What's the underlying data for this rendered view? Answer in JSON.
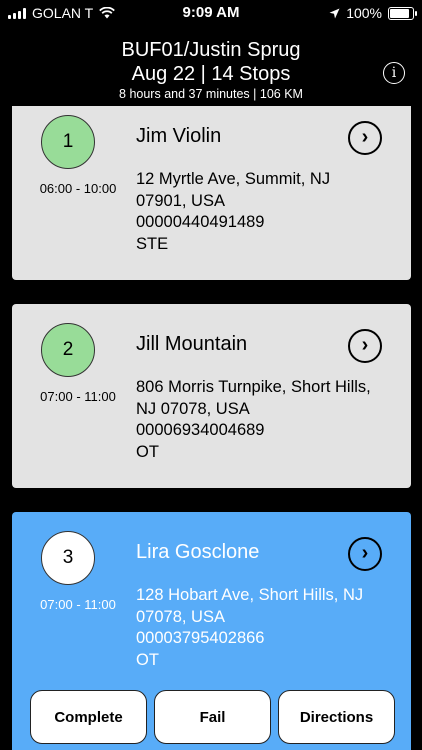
{
  "status_bar": {
    "carrier": "GOLAN T",
    "time": "9:09 AM",
    "battery": "100%",
    "battery_level": 1.0
  },
  "header": {
    "title": "BUF01/Justin Sprug",
    "subtitle": "Aug 22 | 14 Stops",
    "meta": "8 hours and 37 minutes | 106 KM",
    "info_icon": "i"
  },
  "stops": [
    {
      "number": "1",
      "time_window": "06:00 - 10:00",
      "name": "Jim Violin",
      "address_line1": "12 Myrtle Ave, Summit, NJ",
      "address_line2": "07901, USA",
      "order_id": "00000440491489",
      "code": "STE"
    },
    {
      "number": "2",
      "time_window": "07:00 - 11:00",
      "name": "Jill Mountain",
      "address_line1": "806 Morris Turnpike, Short Hills,",
      "address_line2": "NJ 07078, USA",
      "order_id": "00006934004689",
      "code": "OT"
    },
    {
      "number": "3",
      "time_window": "07:00 - 11:00",
      "name": "Lira Gosclone",
      "address_line1": "128 Hobart Ave, Short Hills, NJ",
      "address_line2": "07078, USA",
      "order_id": "00003795402866",
      "code": "OT"
    }
  ],
  "actions": {
    "complete": "Complete",
    "fail": "Fail",
    "directions": "Directions"
  },
  "icons": {
    "chevron": "›"
  },
  "colors": {
    "card_default": "#e3e3e3",
    "card_active": "#58acf8",
    "circle_done": "#98dc98"
  }
}
